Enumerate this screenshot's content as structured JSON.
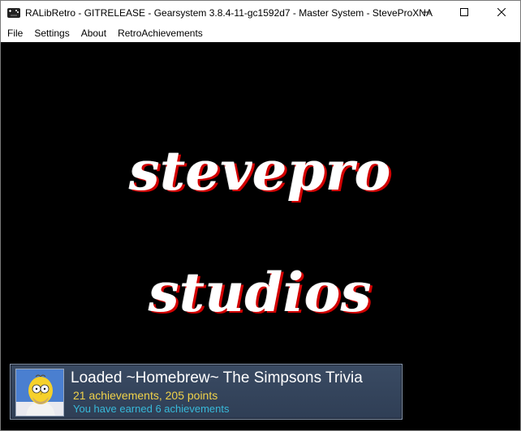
{
  "window": {
    "title": "RALibRetro - GITRELEASE - Gearsystem 3.8.4-11-gc1592d7 - Master System - SteveProXNA",
    "controls": [
      "minimize-icon",
      "maximize-icon",
      "close-icon"
    ]
  },
  "menubar": {
    "items": [
      "File",
      "Settings",
      "About",
      "RetroAchievements"
    ]
  },
  "game_screen": {
    "logo_line1": "stevepro",
    "logo_line2": "studios"
  },
  "popup": {
    "title": "Loaded ~Homebrew~ The Simpsons Trivia",
    "achievements_line": "21 achievements, 205 points",
    "earned_line": "You have earned 6 achievements",
    "badge_icon": "homer-simpson-badge-icon"
  },
  "colors": {
    "game_background": "#000000",
    "popup_background": "#34445c",
    "popup_title": "#ffffff",
    "achievements_text": "#f0d24a",
    "earned_text": "#38b9d9"
  }
}
